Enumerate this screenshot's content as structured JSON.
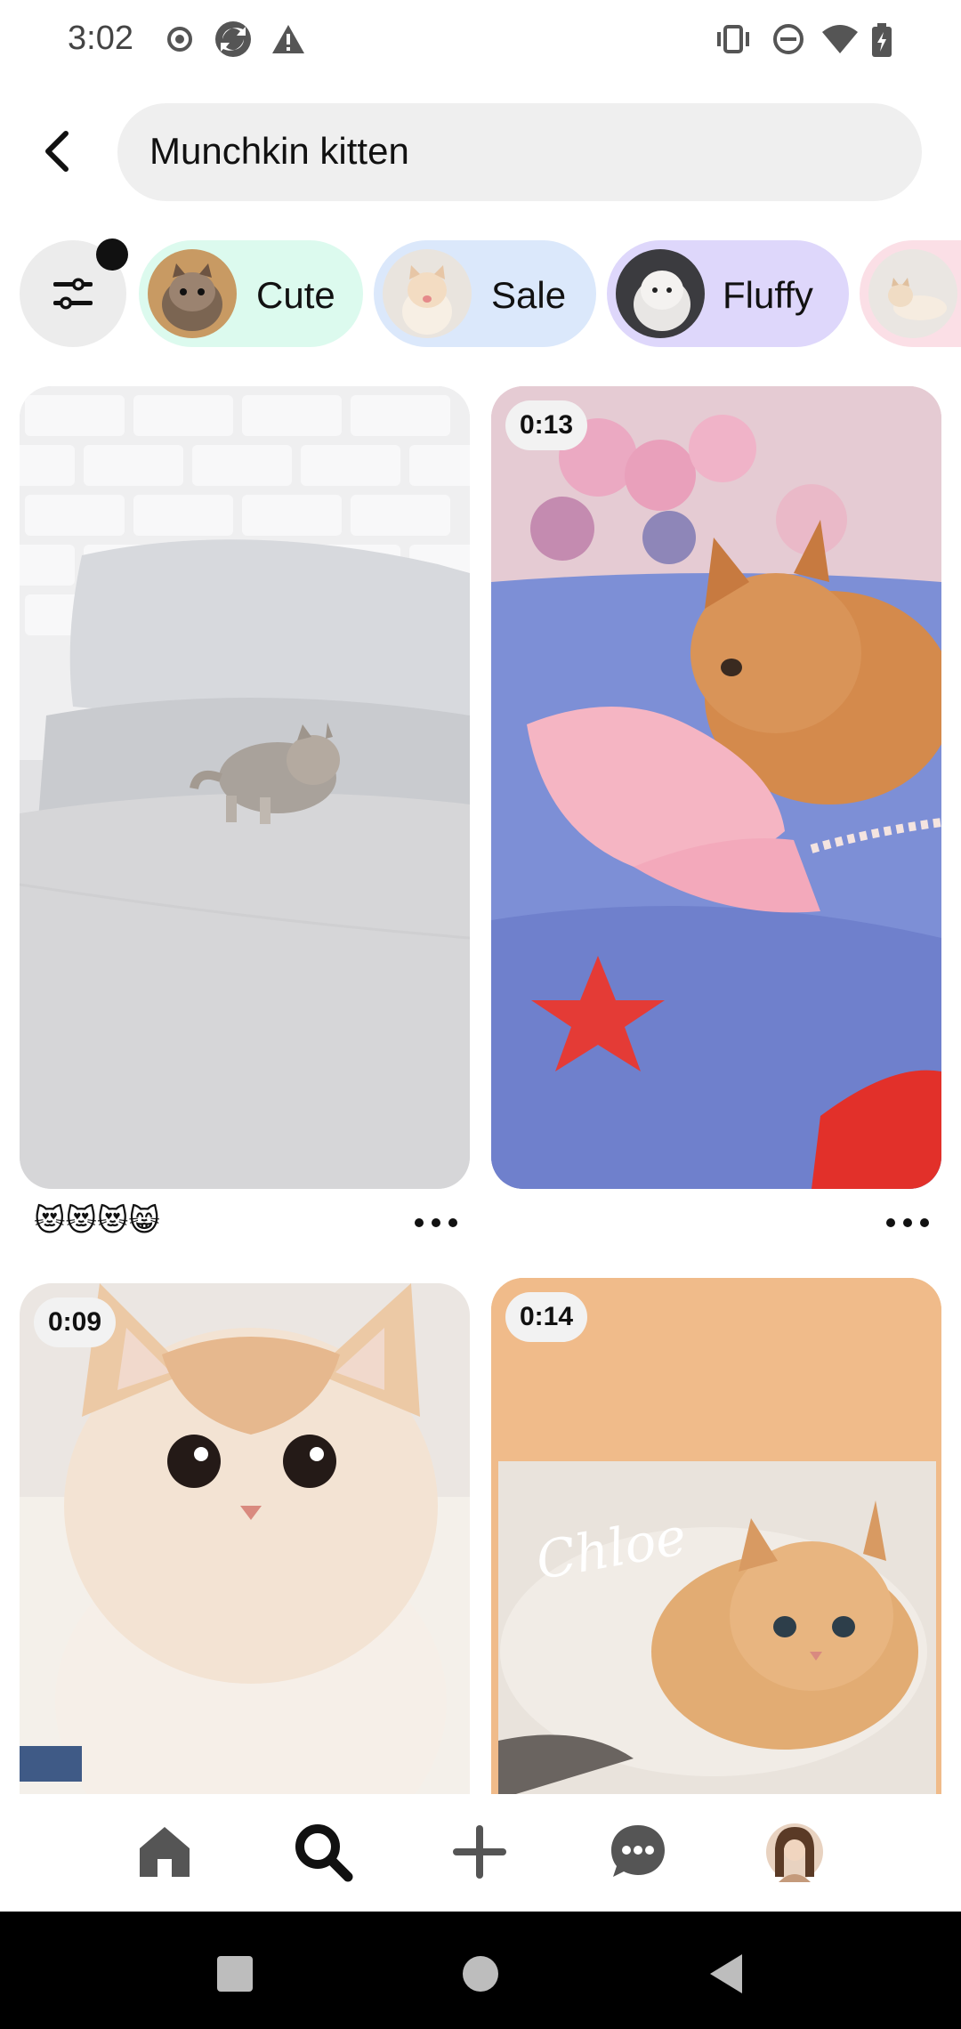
{
  "status_bar": {
    "time": "3:02",
    "left_icons": [
      "record-icon",
      "sync-icon",
      "warning-icon"
    ],
    "right_icons": [
      "vibrate-icon",
      "do-not-disturb-icon",
      "wifi-icon",
      "battery-charging-icon"
    ]
  },
  "search": {
    "query": "Munchkin kitten",
    "back_icon": "back-arrow-icon"
  },
  "filter_button": {
    "icon": "sliders-icon",
    "has_indicator": true
  },
  "chips": [
    {
      "label": "Cute",
      "bg": "#dcfaee"
    },
    {
      "label": "Sale",
      "bg": "#dbe8fb"
    },
    {
      "label": "Fluffy",
      "bg": "#ded7fb"
    },
    {
      "label": "",
      "bg": "#fbdfe6"
    }
  ],
  "pins": [
    {
      "id": "pin-1",
      "duration": "",
      "caption": "😻😻😻😸"
    },
    {
      "id": "pin-2",
      "duration": "0:13",
      "caption": ""
    },
    {
      "id": "pin-3",
      "duration": "0:09",
      "caption": ""
    },
    {
      "id": "pin-4",
      "duration": "0:14",
      "caption": "",
      "overlay_text": "Chloe"
    }
  ],
  "bottom_nav": {
    "items": [
      "home-icon",
      "search-icon",
      "create-icon",
      "messages-icon",
      "profile-avatar"
    ],
    "active": "search-icon"
  },
  "system_nav": [
    "recents-icon",
    "home-circle-icon",
    "back-triangle-icon"
  ],
  "colors": {
    "search_bg": "#efefef",
    "chip_cute": "#dcfaee",
    "chip_sale": "#dbe8fb",
    "chip_fluffy": "#ded7fb",
    "pin4_bg": "#f0bb8a"
  }
}
